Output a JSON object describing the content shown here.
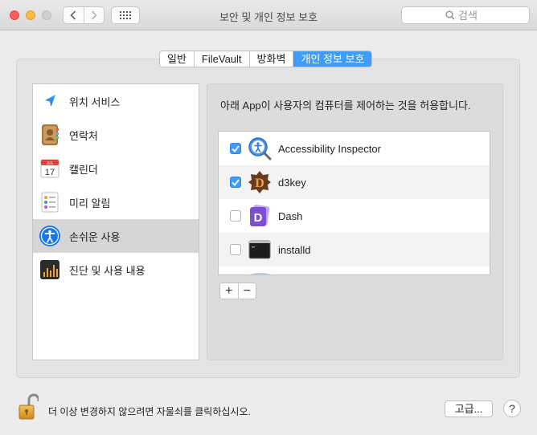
{
  "window": {
    "title": "보안 및 개인 정보 보호"
  },
  "toolbar": {
    "back_icon": "chevron-left-icon",
    "forward_icon": "chevron-right-icon",
    "show_all_icon": "grid-icon",
    "search": {
      "placeholder": "검색",
      "icon": "search-icon"
    }
  },
  "tabs": [
    {
      "label": "일반",
      "active": false
    },
    {
      "label": "FileVault",
      "active": false
    },
    {
      "label": "방화벽",
      "active": false
    },
    {
      "label": "개인 정보 보호",
      "active": true
    }
  ],
  "sidebar": {
    "items": [
      {
        "label": "위치 서비스",
        "icon": "location-arrow-icon",
        "selected": false
      },
      {
        "label": "연락처",
        "icon": "contacts-book-icon",
        "selected": false
      },
      {
        "label": "캘린더",
        "icon": "calendar-icon",
        "selected": false,
        "icon_text": {
          "month": "JUL",
          "day": "17"
        }
      },
      {
        "label": "미리 알림",
        "icon": "reminders-icon",
        "selected": false
      },
      {
        "label": "손쉬운 사용",
        "icon": "accessibility-icon",
        "selected": true
      },
      {
        "label": "진단 및 사용 내용",
        "icon": "diagnostics-icon",
        "selected": false
      }
    ]
  },
  "main": {
    "description": "아래 App이 사용자의 컴퓨터를 제어하는 것을 허용합니다.",
    "apps": [
      {
        "name": "Accessibility Inspector",
        "checked": true,
        "icon": "accessibility-inspector-icon"
      },
      {
        "name": "d3key",
        "checked": true,
        "icon": "d3key-icon",
        "icon_text": "D"
      },
      {
        "name": "Dash",
        "checked": false,
        "icon": "dash-icon",
        "icon_text": "D"
      },
      {
        "name": "installd",
        "checked": false,
        "icon": "terminal-icon"
      }
    ],
    "add_label": "+",
    "remove_label": "−"
  },
  "footer": {
    "lock_text": "더 이상 변경하지 않으려면 자물쇠를 클릭하십시오.",
    "advanced_label": "고급...",
    "help_label": "?"
  },
  "colors": {
    "accent": "#3f9cf8",
    "selection": "#d6d6d6"
  }
}
